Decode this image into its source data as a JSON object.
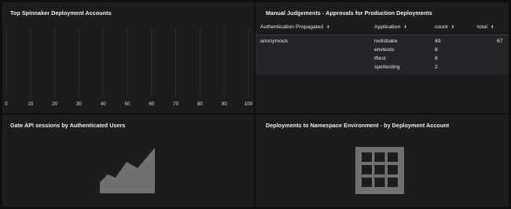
{
  "panels": {
    "top_accounts": {
      "title": "Top Spinnaker Deployment Accounts"
    },
    "judgements": {
      "title": "Manual Judgements - Approvals for Production Deployments",
      "columns": [
        {
          "label": "Authentication Propagated"
        },
        {
          "label": "Application"
        },
        {
          "label": "count"
        },
        {
          "label": "total"
        }
      ],
      "row": {
        "auth": "anonymous",
        "applications": [
          "redisbake",
          "envtests",
          "tftest",
          "speltesting"
        ],
        "counts": [
          "49",
          "8",
          "8",
          "2"
        ],
        "total": "67"
      }
    },
    "gate_sessions": {
      "title": "Gate API sessions by Authenticated Users"
    },
    "deployments_ns": {
      "title": "Deployments to Namespace Environment - by Deployment Account"
    }
  },
  "icons": {
    "sort": "sort-icon",
    "area_placeholder": "area-chart-icon",
    "grid_placeholder": "grid-table-icon"
  },
  "colors": {
    "panel_bg": "#1b1c1e",
    "page_bg": "#0f0f10",
    "placeholder": "#707070"
  },
  "chart_data": {
    "type": "bar",
    "categories": [],
    "values": [],
    "xlim": [
      0,
      100
    ],
    "x_ticks": [
      0,
      10,
      20,
      30,
      40,
      50,
      60,
      70,
      80,
      90,
      100
    ]
  }
}
